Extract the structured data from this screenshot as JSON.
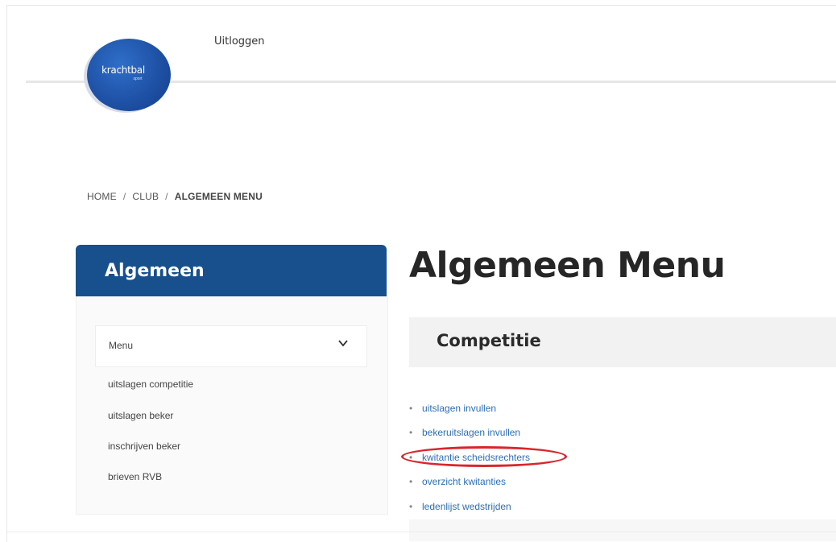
{
  "header": {
    "logo_text": "krachtbal",
    "logo_sub": "sport",
    "logout_label": "Uitloggen"
  },
  "breadcrumb": {
    "home": "HOME",
    "club": "CLUB",
    "current": "ALGEMEEN MENU",
    "separator": "/"
  },
  "sidebar": {
    "title": "Algemeen",
    "menu_label": "Menu",
    "items": [
      {
        "label": "uitslagen competitie"
      },
      {
        "label": "uitslagen beker"
      },
      {
        "label": "inschrijven beker"
      },
      {
        "label": "brieven RVB"
      }
    ]
  },
  "main": {
    "title": "Algemeen Menu",
    "section_title": "Competitie",
    "links": [
      {
        "label": "uitslagen invullen"
      },
      {
        "label": "bekeruitslagen invullen"
      },
      {
        "label": "kwitantie scheidsrechters"
      },
      {
        "label": "overzicht kwitanties"
      },
      {
        "label": "ledenlijst wedstrijden"
      }
    ]
  },
  "colors": {
    "brand_blue": "#17508d",
    "link_blue": "#2d6fb4",
    "highlight_red": "#d9262c"
  }
}
